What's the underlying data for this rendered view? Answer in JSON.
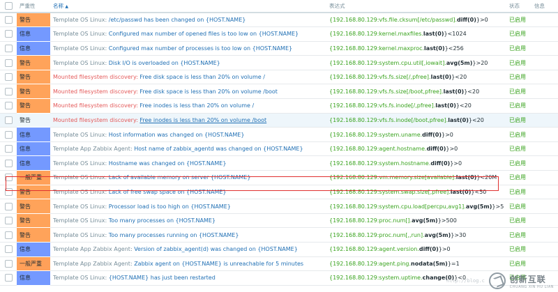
{
  "header": {
    "severity": "严重性",
    "name": "名称",
    "expression": "表达式",
    "status": "状态",
    "info": "信息"
  },
  "severity_colors": {
    "warning": "#ffa35a",
    "info": "#7499ff",
    "average": "#ffa059"
  },
  "rows": [
    {
      "severity": "警告",
      "level": "warning",
      "prefix": "Template OS Linux:",
      "name": "/etc/passwd has been changed on {HOST.NAME}",
      "expr_host": "{192.168.80.129:vfs.file.cksum[/etc/passwd].",
      "expr_fn": "diff(0)",
      "expr_tail": "}>0",
      "status": "已启用"
    },
    {
      "severity": "信息",
      "level": "info",
      "prefix": "Template OS Linux:",
      "name": "Configured max number of opened files is too low on {HOST.NAME}",
      "expr_host": "{192.168.80.129:kernel.maxfiles.",
      "expr_fn": "last(0)",
      "expr_tail": "}<1024",
      "status": "已启用"
    },
    {
      "severity": "信息",
      "level": "info",
      "prefix": "Template OS Linux:",
      "name": "Configured max number of processes is too low on {HOST.NAME}",
      "expr_host": "{192.168.80.129:kernel.maxproc.",
      "expr_fn": "last(0)",
      "expr_tail": "}<256",
      "status": "已启用"
    },
    {
      "severity": "警告",
      "level": "warning",
      "prefix": "Template OS Linux:",
      "name": "Disk I/O is overloaded on {HOST.NAME}",
      "expr_host": "{192.168.80.129:system.cpu.util[,iowait].",
      "expr_fn": "avg(5m)",
      "expr_tail": "}>20",
      "status": "已启用"
    },
    {
      "severity": "警告",
      "level": "warning",
      "prefix": "Mounted filesystem discovery:",
      "name": "Free disk space is less than 20% on volume /",
      "expr_host": "{192.168.80.129:vfs.fs.size[/,pfree].",
      "expr_fn": "last(0)",
      "expr_tail": "}<20",
      "status": "已启用"
    },
    {
      "severity": "警告",
      "level": "warning",
      "prefix": "Mounted filesystem discovery:",
      "name": "Free disk space is less than 20% on volume /boot",
      "expr_host": "{192.168.80.129:vfs.fs.size[/boot,pfree].",
      "expr_fn": "last(0)",
      "expr_tail": "}<20",
      "status": "已启用"
    },
    {
      "severity": "警告",
      "level": "warning",
      "prefix": "Mounted filesystem discovery:",
      "name": "Free inodes is less than 20% on volume /",
      "expr_host": "{192.168.80.129:vfs.fs.inode[/,pfree].",
      "expr_fn": "last(0)",
      "expr_tail": "}<20",
      "status": "已启用"
    },
    {
      "severity": "警告",
      "level": "warning",
      "prefix": "Mounted filesystem discovery:",
      "name": "Free inodes is less than 20% on volume /boot",
      "expr_host": "{192.168.80.129:vfs.fs.inode[/boot,pfree].",
      "expr_fn": "last(0)",
      "expr_tail": "}<20",
      "status": "已启用"
    },
    {
      "severity": "信息",
      "level": "info",
      "prefix": "Template OS Linux:",
      "name": "Host information was changed on {HOST.NAME}",
      "expr_host": "{192.168.80.129:system.uname.",
      "expr_fn": "diff(0)",
      "expr_tail": "}>0",
      "status": "已启用"
    },
    {
      "severity": "信息",
      "level": "info",
      "prefix": "Template App Zabbix Agent:",
      "name": "Host name of zabbix_agentd was changed on {HOST.NAME}",
      "expr_host": "{192.168.80.129:agent.hostname.",
      "expr_fn": "diff(0)",
      "expr_tail": "}>0",
      "status": "已启用"
    },
    {
      "severity": "信息",
      "level": "info",
      "prefix": "Template OS Linux:",
      "name": "Hostname was changed on {HOST.NAME}",
      "expr_host": "{192.168.80.129:system.hostname.",
      "expr_fn": "diff(0)",
      "expr_tail": "}>0",
      "status": "已启用"
    },
    {
      "severity": "一般严重",
      "level": "average",
      "prefix": "Template OS Linux:",
      "name": "Lack of available memory on server {HOST.NAME}",
      "expr_host": "{192.168.80.129:vm.memory.size[available].",
      "expr_fn": "last(0)",
      "expr_tail": "}<20M",
      "status": "已启用"
    },
    {
      "severity": "警告",
      "level": "warning",
      "prefix": "Template OS Linux:",
      "name": "Lack of free swap space on {HOST.NAME}",
      "expr_host": "{192.168.80.129:system.swap.size[,pfree].",
      "expr_fn": "last(0)",
      "expr_tail": "}<50",
      "status": "已启用"
    },
    {
      "severity": "警告",
      "level": "warning",
      "prefix": "Template OS Linux:",
      "name": "Processor load is too high on {HOST.NAME}",
      "expr_host": "{192.168.80.129:system.cpu.load[percpu,avg1].",
      "expr_fn": "avg(5m)",
      "expr_tail": "}>5",
      "status": "已启用"
    },
    {
      "severity": "警告",
      "level": "warning",
      "prefix": "Template OS Linux:",
      "name": "Too many processes on {HOST.NAME}",
      "expr_host": "{192.168.80.129:proc.num[].",
      "expr_fn": "avg(5m)",
      "expr_tail": "}>500",
      "status": "已启用"
    },
    {
      "severity": "警告",
      "level": "warning",
      "prefix": "Template OS Linux:",
      "name": "Too many processes running on {HOST.NAME}",
      "expr_host": "{192.168.80.129:proc.num[,,run].",
      "expr_fn": "avg(5m)",
      "expr_tail": "}>30",
      "status": "已启用"
    },
    {
      "severity": "信息",
      "level": "info",
      "prefix": "Template App Zabbix Agent:",
      "name": "Version of zabbix_agent(d) was changed on {HOST.NAME}",
      "expr_host": "{192.168.80.129:agent.version.",
      "expr_fn": "diff(0)",
      "expr_tail": "}>0",
      "status": "已启用"
    },
    {
      "severity": "一般严重",
      "level": "average",
      "prefix": "Template App Zabbix Agent:",
      "name": "Zabbix agent on {HOST.NAME} is unreachable for 5 minutes",
      "expr_host": "{192.168.80.129:agent.ping.",
      "expr_fn": "nodata(5m)",
      "expr_tail": "}=1",
      "status": "已启用"
    },
    {
      "severity": "信息",
      "level": "info",
      "prefix": "Template OS Linux:",
      "name": "{HOST.NAME} has just been restarted",
      "expr_host": "{192.168.80.129:system.uptime.",
      "expr_fn": "change(0)",
      "expr_tail": "}<0",
      "status": "已启用"
    }
  ],
  "watermark": {
    "url": "http://blog.c",
    "brand_cn": "创新互联",
    "brand_en": "CHUANG XIN HU LIAN"
  }
}
